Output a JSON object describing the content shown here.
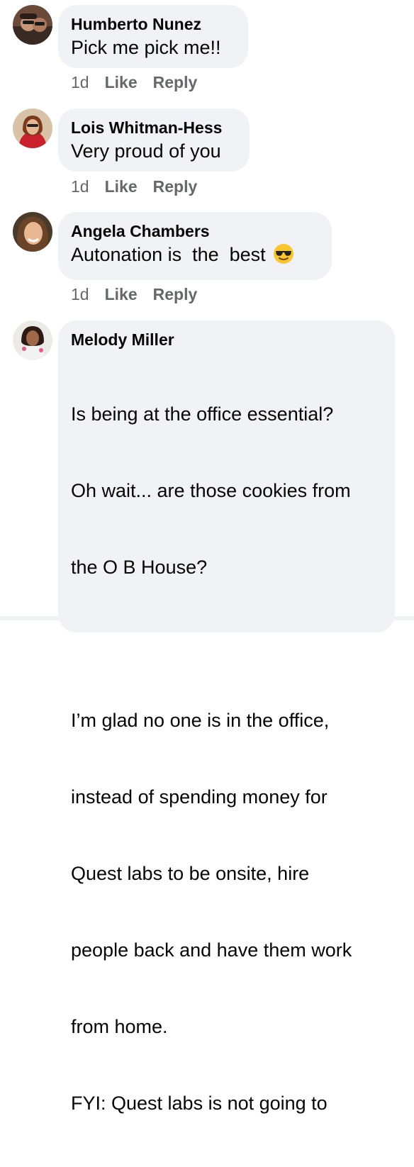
{
  "comments": [
    {
      "author": "Humberto Nunez",
      "text": "Pick me pick me!!",
      "time": "1d",
      "like_label": "Like",
      "reply_label": "Reply",
      "avatar": "avatar-photo"
    },
    {
      "author": "Lois Whitman-Hess",
      "text": "Very proud of you",
      "time": "1d",
      "like_label": "Like",
      "reply_label": "Reply",
      "avatar": "avatar-photo"
    },
    {
      "author": "Angela Chambers",
      "text": "Autonation is  the  best",
      "emoji": "smiling-face-with-sunglasses-icon",
      "time": "1d",
      "like_label": "Like",
      "reply_label": "Reply",
      "avatar": "avatar-photo"
    },
    {
      "author": "Melody Miller",
      "lines": [
        "Is being at the office essential?",
        "Oh wait... are those cookies from",
        "the O B House?",
        "",
        "I’m glad no one is in the office,",
        "instead of spending money for",
        "Quest labs to be onsite, hire",
        "people back and have them work",
        "from home.",
        "FYI: Quest labs is not going to"
      ],
      "avatar": "avatar-photo"
    }
  ],
  "colors": {
    "bubble": "#f0f2f5",
    "text": "#050505",
    "meta": "#65676b"
  }
}
